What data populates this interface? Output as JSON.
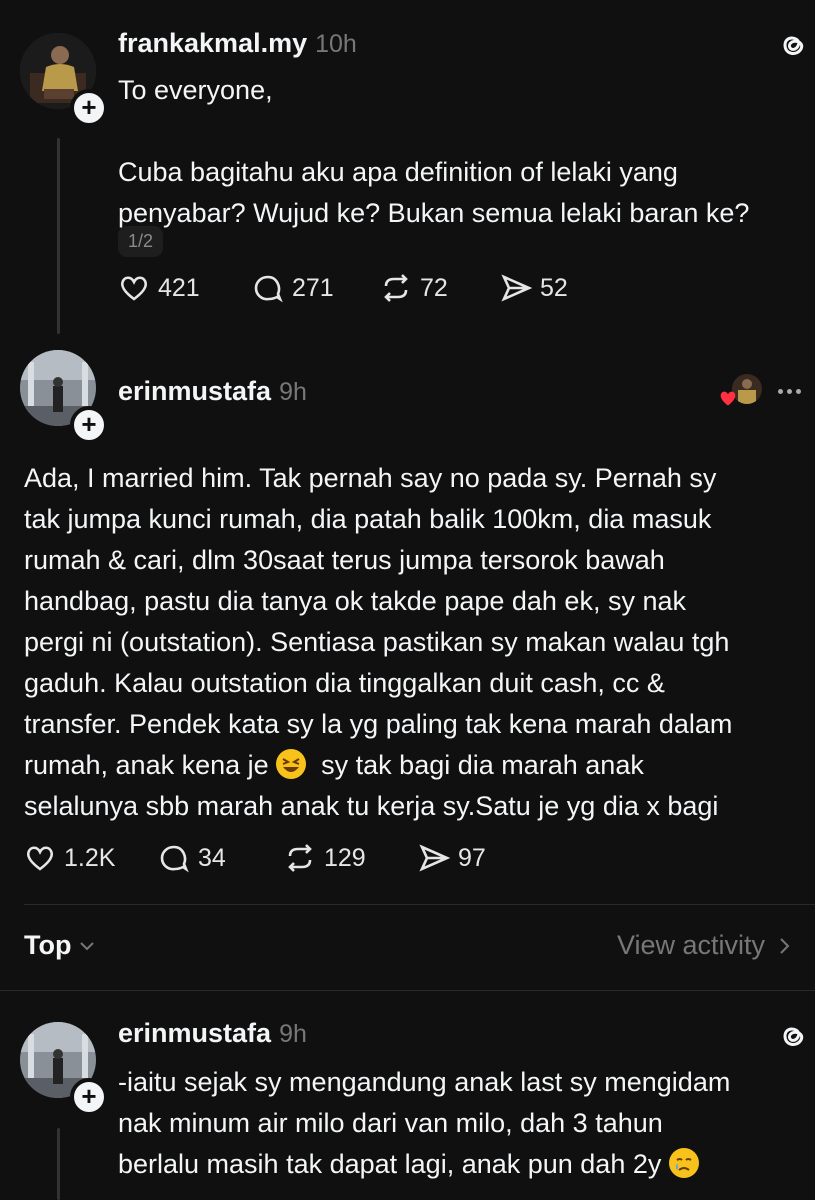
{
  "post1": {
    "username": "frankakmal.my",
    "time": "10h",
    "body": "To everyone,\n\nCuba bagitahu aku apa definition of lelaki yang\npenyabar? Wujud ke? Bukan semua lelaki baran ke?",
    "pager": "1/2",
    "likes": "421",
    "replies": "271",
    "reposts": "72",
    "shares": "52"
  },
  "post2": {
    "username": "erinmustafa",
    "time": "9h",
    "body_before_emoji": "Ada, I married him. Tak pernah say no pada sy. Pernah sy\ntak jumpa kunci rumah, dia patah balik 100km, dia masuk\nrumah & cari, dlm 30saat terus jumpa tersorok bawah\nhandbag, pastu dia tanya ok takde pape dah ek, sy nak\npergi ni (outstation). Sentiasa pastikan sy makan walau tgh\ngaduh. Kalau outstation dia tinggalkan duit cash, cc &\ntransfer. Pendek kata sy la yg paling tak kena marah dalam\nrumah, anak kena je ",
    "body_after_emoji": "  sy tak bagi dia marah anak\nselalunya sbb marah anak tu kerja sy.Satu je yg dia x bagi",
    "likes": "1.2K",
    "replies": "34",
    "reposts": "129",
    "shares": "97"
  },
  "sort_bar": {
    "sort_label": "Top",
    "view_activity": "View activity"
  },
  "post3": {
    "username": "erinmustafa",
    "time": "9h",
    "body": "-iaitu sejak sy mengandung anak last sy mengidam\nnak minum air milo dari van milo, dah 3 tahun\nberlalu masih tak dapat lagi, anak pun dah 2y "
  },
  "colors": {
    "background": "#101010",
    "text": "#f3f5f7",
    "muted": "#777777",
    "heart_red": "#ff3040"
  }
}
